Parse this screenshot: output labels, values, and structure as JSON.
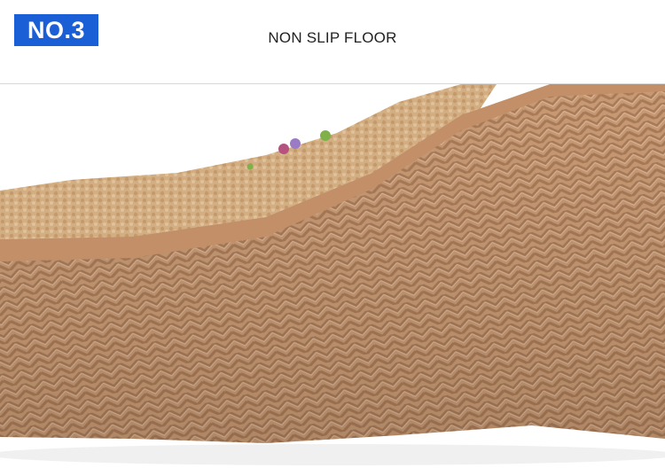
{
  "header": {
    "badge_label": "NO.3",
    "title": "NON SLIP FLOOR"
  },
  "colors": {
    "badge_bg": "#1a5fd6",
    "sole": "#c89a74",
    "straw": "#d2ae82"
  }
}
